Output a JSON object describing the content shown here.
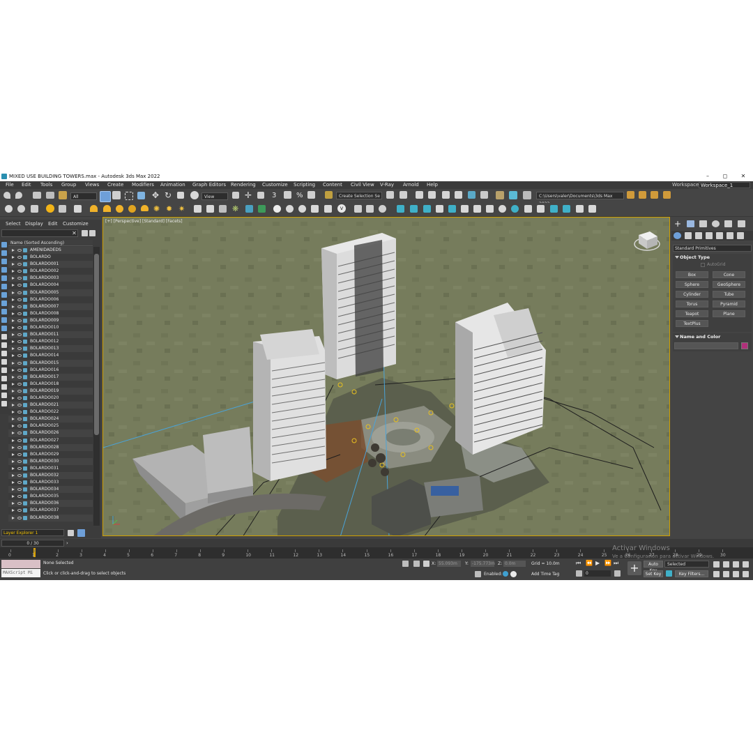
{
  "window": {
    "title": "MIXED USE BUILDING TOWERS.max - Autodesk 3ds Max 2022",
    "minimize": "–",
    "maximize": "◻",
    "close": "✕"
  },
  "menu": {
    "items": [
      "File",
      "Edit",
      "Tools",
      "Group",
      "Views",
      "Create",
      "Modifiers",
      "Animation",
      "Graph Editors",
      "Rendering",
      "Customize",
      "Scripting",
      "Content",
      "Civil View",
      "V-Ray",
      "Arnold",
      "Help"
    ],
    "workspaces_label": "Workspaces:",
    "workspace_value": "Workspace_1"
  },
  "toolbar": {
    "filter_value": "All",
    "view_value": "View",
    "selection_set_value": "Create Selection Se",
    "project_path": "C:\\Users\\valer\\Documents\\3ds Max 2022"
  },
  "explorer": {
    "menu": [
      "Select",
      "Display",
      "Edit",
      "Customize"
    ],
    "column_header": "Name (Sorted Ascending)",
    "rows": [
      "AMENIDADEDS",
      "BOLARDO",
      "BOLARDO001",
      "BOLARDO002",
      "BOLARDO003",
      "BOLARDO004",
      "BOLARDO005",
      "BOLARDO006",
      "BOLARDO007",
      "BOLARDO008",
      "BOLARDO009",
      "BOLARDO010",
      "BOLARDO011",
      "BOLARDO012",
      "BOLARDO013",
      "BOLARDO014",
      "BOLARDO015",
      "BOLARDO016",
      "BOLARDO017",
      "BOLARDO018",
      "BOLARDO019",
      "BOLARDO020",
      "BOLARDO021",
      "BOLARDO022",
      "BOLARDO024",
      "BOLARDO025",
      "BOLARDO026",
      "BOLARDO027",
      "BOLARDO028",
      "BOLARDO029",
      "BOLARDO030",
      "BOLARDO031",
      "BOLARDO032",
      "BOLARDO033",
      "BOLARDO034",
      "BOLARDO035",
      "BOLARDO036",
      "BOLARDO037",
      "BOLARDO038"
    ],
    "layer_explorer": "Layer Explorer 1"
  },
  "viewport": {
    "label_parts": [
      "[+]",
      "[Perspective]",
      "[Standard]",
      "[Facets]"
    ],
    "ground_color": "#767d5d",
    "border_color": "#d0a000"
  },
  "command_panel": {
    "category": "Standard Primitives",
    "object_type_title": "Object Type",
    "autogrid": "AutoGrid",
    "buttons": [
      "Box",
      "Cone",
      "Sphere",
      "GeoSphere",
      "Cylinder",
      "Tube",
      "Torus",
      "Pyramid",
      "Teapot",
      "Plane",
      "TextPlus"
    ],
    "name_color_title": "Name and Color",
    "swatch_color": "#b0307a"
  },
  "timeline": {
    "frame_counter": "0 / 30",
    "ticks": [
      "0",
      "1",
      "2",
      "3",
      "4",
      "5",
      "6",
      "7",
      "8",
      "9",
      "10",
      "11",
      "12",
      "13",
      "14",
      "15",
      "16",
      "17",
      "18",
      "19",
      "20",
      "21",
      "22",
      "23",
      "24",
      "25",
      "26",
      "27",
      "28",
      "29",
      "30"
    ]
  },
  "status": {
    "maxscript": "MAXScript Mi",
    "selection": "None Selected",
    "prompt": "Click or click-and-drag to select objects",
    "x_label": "X:",
    "x_value": "55.093m",
    "y_label": "Y:",
    "y_value": "-175.773m",
    "z_label": "Z:",
    "z_value": "0.0m",
    "grid": "Grid = 10.0m",
    "enabled": "Enabled:",
    "add_time_tag": "Add Time Tag",
    "auto_key": "Auto Key",
    "set_key": "Set Key",
    "selected": "Selected",
    "key_filters": "Key Filters...",
    "frame_value": "0",
    "watermark_title": "Activar Windows",
    "watermark_sub": "Ve a Configuración para activar Windows."
  }
}
